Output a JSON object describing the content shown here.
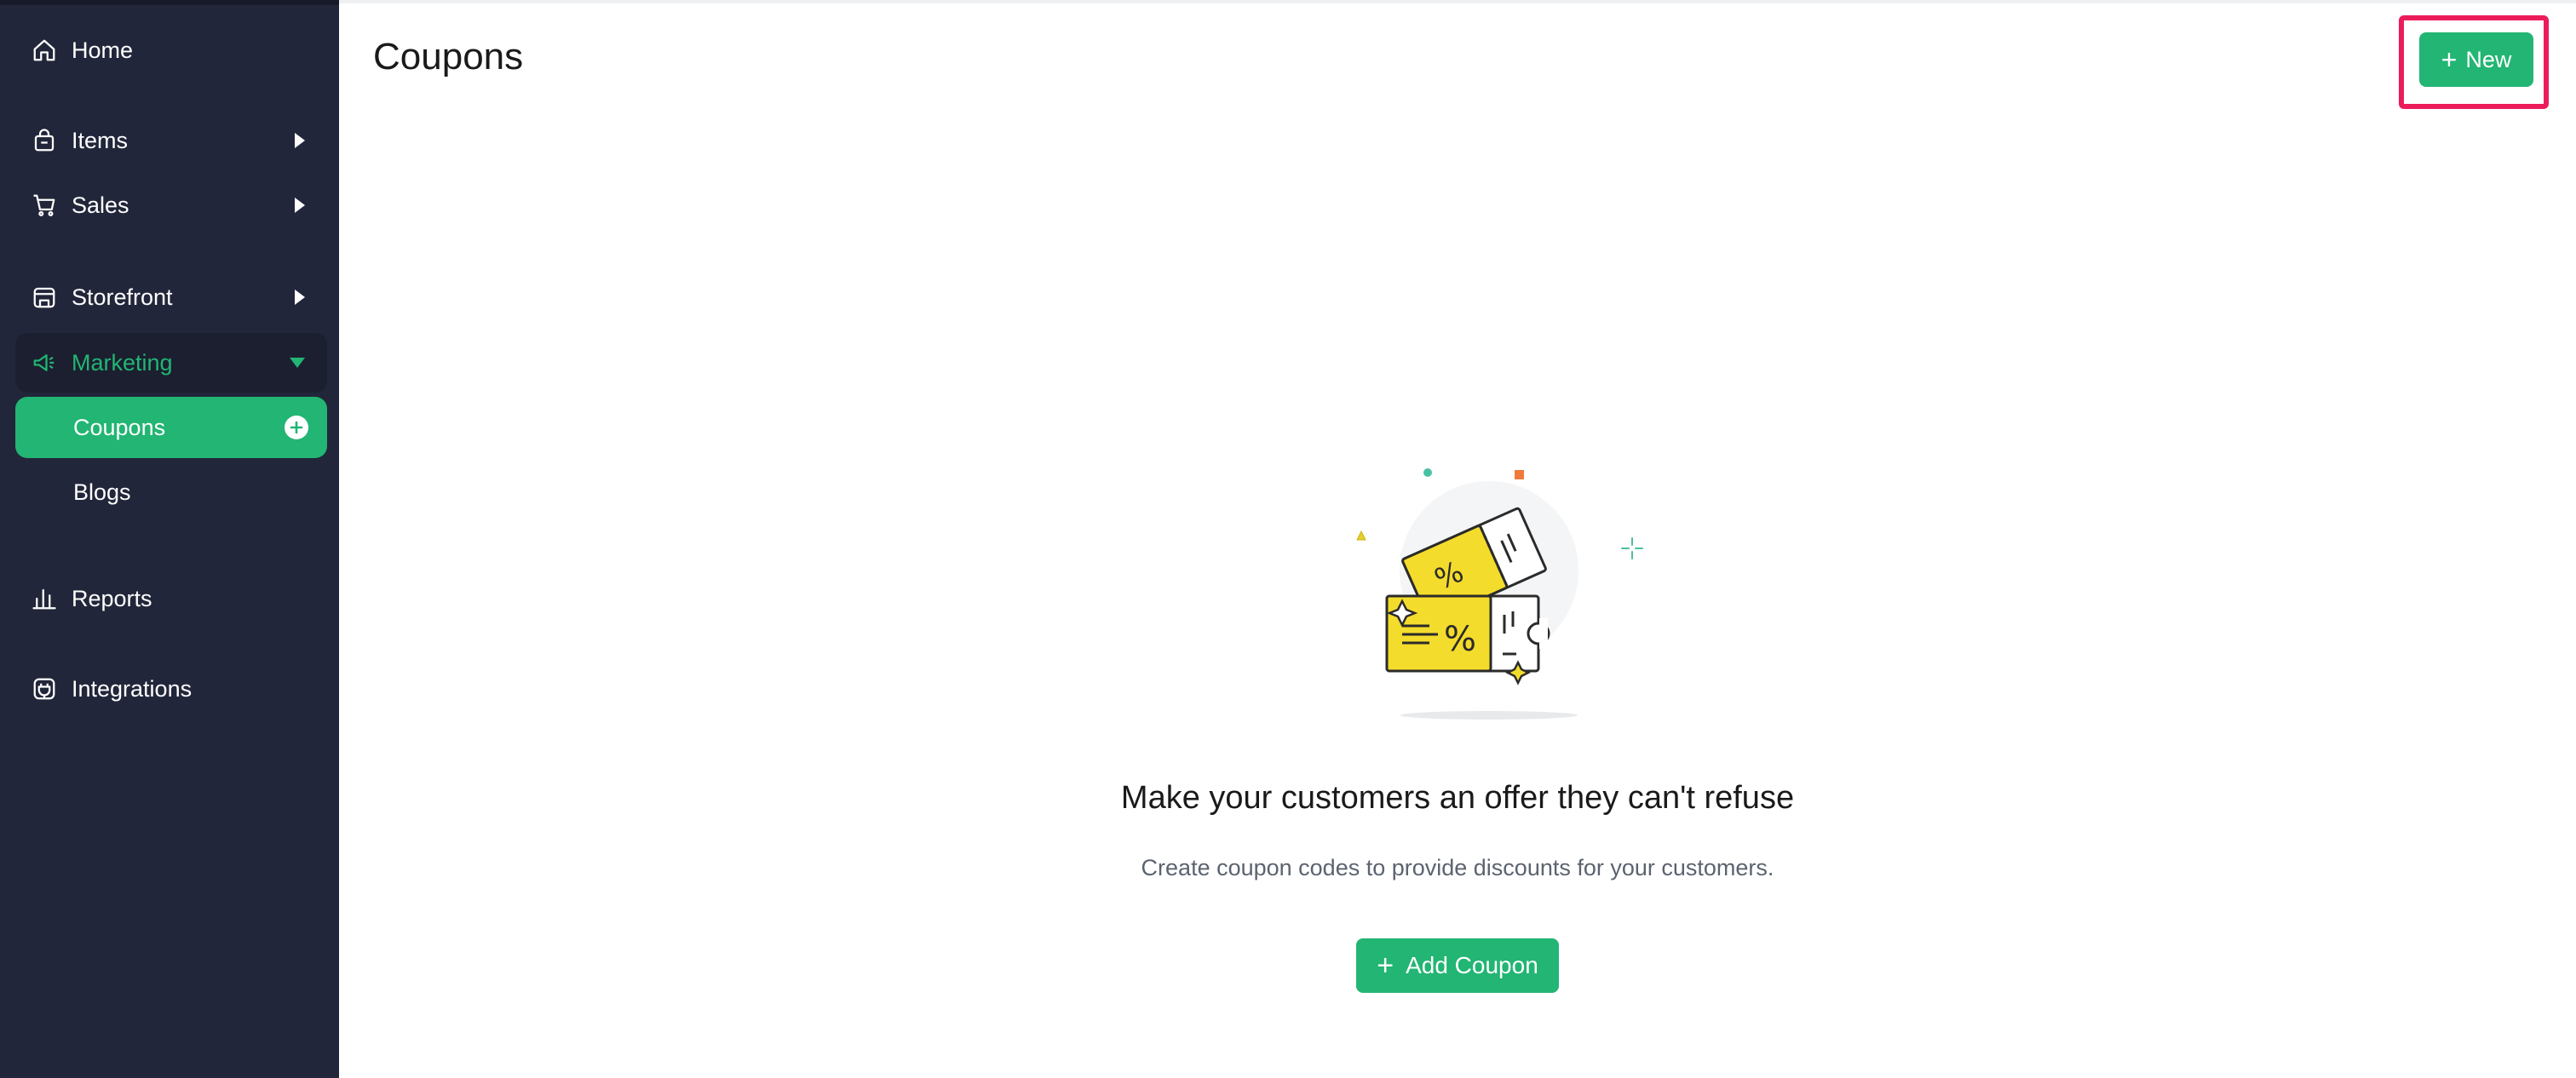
{
  "sidebar": {
    "items": [
      {
        "label": "Home",
        "icon": "home-icon"
      },
      {
        "label": "Items",
        "icon": "bag-icon"
      },
      {
        "label": "Sales",
        "icon": "cart-icon"
      },
      {
        "label": "Storefront",
        "icon": "storefront-icon"
      },
      {
        "label": "Marketing",
        "icon": "megaphone-icon"
      },
      {
        "label": "Reports",
        "icon": "bar-chart-icon"
      },
      {
        "label": "Integrations",
        "icon": "plug-icon"
      }
    ],
    "marketing_sub": [
      {
        "label": "Coupons",
        "active": true
      },
      {
        "label": "Blogs",
        "active": false
      }
    ]
  },
  "main": {
    "title": "Coupons",
    "new_button_label": "New",
    "empty_state": {
      "illustration": "coupon-tickets-illustration",
      "heading": "Make your customers an offer they can't refuse",
      "subtext": "Create coupon codes to provide discounts for your customers.",
      "button_label": "Add Coupon"
    }
  },
  "colors": {
    "sidebar_bg": "#22263a",
    "accent": "#22b573",
    "highlight": "#ec1c5b"
  }
}
